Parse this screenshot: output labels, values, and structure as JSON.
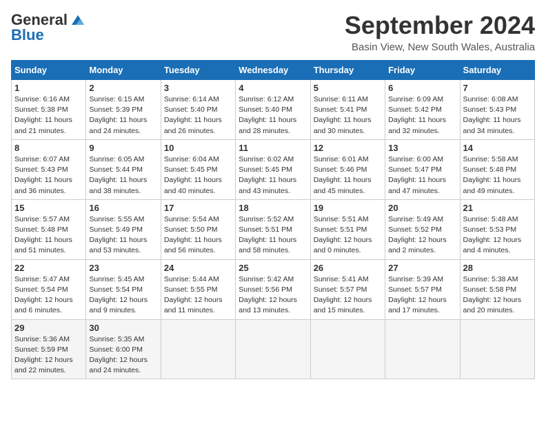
{
  "header": {
    "logo_line1": "General",
    "logo_line2": "Blue",
    "month": "September 2024",
    "location": "Basin View, New South Wales, Australia"
  },
  "days_of_week": [
    "Sunday",
    "Monday",
    "Tuesday",
    "Wednesday",
    "Thursday",
    "Friday",
    "Saturday"
  ],
  "weeks": [
    [
      {
        "day": "1",
        "sunrise": "6:16 AM",
        "sunset": "5:38 PM",
        "daylight": "11 hours and 21 minutes."
      },
      {
        "day": "2",
        "sunrise": "6:15 AM",
        "sunset": "5:39 PM",
        "daylight": "11 hours and 24 minutes."
      },
      {
        "day": "3",
        "sunrise": "6:14 AM",
        "sunset": "5:40 PM",
        "daylight": "11 hours and 26 minutes."
      },
      {
        "day": "4",
        "sunrise": "6:12 AM",
        "sunset": "5:40 PM",
        "daylight": "11 hours and 28 minutes."
      },
      {
        "day": "5",
        "sunrise": "6:11 AM",
        "sunset": "5:41 PM",
        "daylight": "11 hours and 30 minutes."
      },
      {
        "day": "6",
        "sunrise": "6:09 AM",
        "sunset": "5:42 PM",
        "daylight": "11 hours and 32 minutes."
      },
      {
        "day": "7",
        "sunrise": "6:08 AM",
        "sunset": "5:43 PM",
        "daylight": "11 hours and 34 minutes."
      }
    ],
    [
      {
        "day": "8",
        "sunrise": "6:07 AM",
        "sunset": "5:43 PM",
        "daylight": "11 hours and 36 minutes."
      },
      {
        "day": "9",
        "sunrise": "6:05 AM",
        "sunset": "5:44 PM",
        "daylight": "11 hours and 38 minutes."
      },
      {
        "day": "10",
        "sunrise": "6:04 AM",
        "sunset": "5:45 PM",
        "daylight": "11 hours and 40 minutes."
      },
      {
        "day": "11",
        "sunrise": "6:02 AM",
        "sunset": "5:45 PM",
        "daylight": "11 hours and 43 minutes."
      },
      {
        "day": "12",
        "sunrise": "6:01 AM",
        "sunset": "5:46 PM",
        "daylight": "11 hours and 45 minutes."
      },
      {
        "day": "13",
        "sunrise": "6:00 AM",
        "sunset": "5:47 PM",
        "daylight": "11 hours and 47 minutes."
      },
      {
        "day": "14",
        "sunrise": "5:58 AM",
        "sunset": "5:48 PM",
        "daylight": "11 hours and 49 minutes."
      }
    ],
    [
      {
        "day": "15",
        "sunrise": "5:57 AM",
        "sunset": "5:48 PM",
        "daylight": "11 hours and 51 minutes."
      },
      {
        "day": "16",
        "sunrise": "5:55 AM",
        "sunset": "5:49 PM",
        "daylight": "11 hours and 53 minutes."
      },
      {
        "day": "17",
        "sunrise": "5:54 AM",
        "sunset": "5:50 PM",
        "daylight": "11 hours and 56 minutes."
      },
      {
        "day": "18",
        "sunrise": "5:52 AM",
        "sunset": "5:51 PM",
        "daylight": "11 hours and 58 minutes."
      },
      {
        "day": "19",
        "sunrise": "5:51 AM",
        "sunset": "5:51 PM",
        "daylight": "12 hours and 0 minutes."
      },
      {
        "day": "20",
        "sunrise": "5:49 AM",
        "sunset": "5:52 PM",
        "daylight": "12 hours and 2 minutes."
      },
      {
        "day": "21",
        "sunrise": "5:48 AM",
        "sunset": "5:53 PM",
        "daylight": "12 hours and 4 minutes."
      }
    ],
    [
      {
        "day": "22",
        "sunrise": "5:47 AM",
        "sunset": "5:54 PM",
        "daylight": "12 hours and 6 minutes."
      },
      {
        "day": "23",
        "sunrise": "5:45 AM",
        "sunset": "5:54 PM",
        "daylight": "12 hours and 9 minutes."
      },
      {
        "day": "24",
        "sunrise": "5:44 AM",
        "sunset": "5:55 PM",
        "daylight": "12 hours and 11 minutes."
      },
      {
        "day": "25",
        "sunrise": "5:42 AM",
        "sunset": "5:56 PM",
        "daylight": "12 hours and 13 minutes."
      },
      {
        "day": "26",
        "sunrise": "5:41 AM",
        "sunset": "5:57 PM",
        "daylight": "12 hours and 15 minutes."
      },
      {
        "day": "27",
        "sunrise": "5:39 AM",
        "sunset": "5:57 PM",
        "daylight": "12 hours and 17 minutes."
      },
      {
        "day": "28",
        "sunrise": "5:38 AM",
        "sunset": "5:58 PM",
        "daylight": "12 hours and 20 minutes."
      }
    ],
    [
      {
        "day": "29",
        "sunrise": "5:36 AM",
        "sunset": "5:59 PM",
        "daylight": "12 hours and 22 minutes."
      },
      {
        "day": "30",
        "sunrise": "5:35 AM",
        "sunset": "6:00 PM",
        "daylight": "12 hours and 24 minutes."
      },
      null,
      null,
      null,
      null,
      null
    ]
  ],
  "labels": {
    "sunrise": "Sunrise: ",
    "sunset": "Sunset: ",
    "daylight": "Daylight: "
  }
}
